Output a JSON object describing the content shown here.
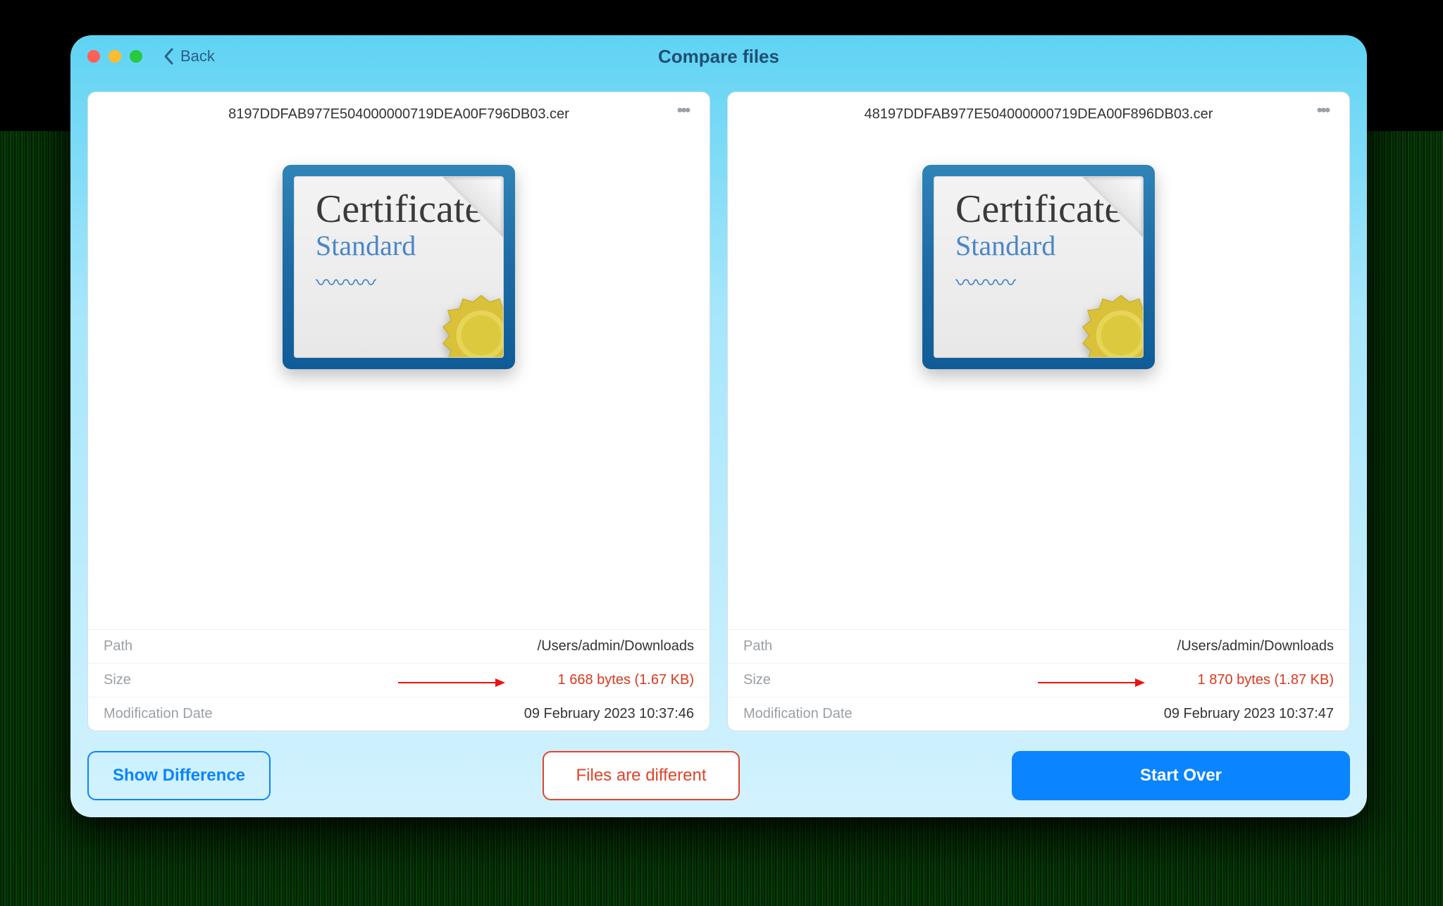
{
  "header": {
    "back_label": "Back",
    "title": "Compare files"
  },
  "files": [
    {
      "name": "8197DDFAB977E504000000719DEA00F796DB03.cer",
      "icon_kind": "certificate",
      "icon_line1": "Certificate",
      "icon_line2": "Standard",
      "props_label": {
        "path": "Path",
        "size": "Size",
        "mod": "Modification Date"
      },
      "path": "/Users/admin/Downloads",
      "size": "1 668 bytes (1.67 KB)",
      "size_differs": true,
      "modification_date": "09 February 2023 10:37:46"
    },
    {
      "name": "48197DDFAB977E504000000719DEA00F896DB03.cer",
      "icon_kind": "certificate",
      "icon_line1": "Certificate",
      "icon_line2": "Standard",
      "props_label": {
        "path": "Path",
        "size": "Size",
        "mod": "Modification Date"
      },
      "path": "/Users/admin/Downloads",
      "size": "1 870 bytes (1.87 KB)",
      "size_differs": true,
      "modification_date": "09 February 2023 10:37:47"
    }
  ],
  "footer": {
    "show_difference_label": "Show Difference",
    "status_label": "Files are different",
    "start_over_label": "Start Over"
  }
}
